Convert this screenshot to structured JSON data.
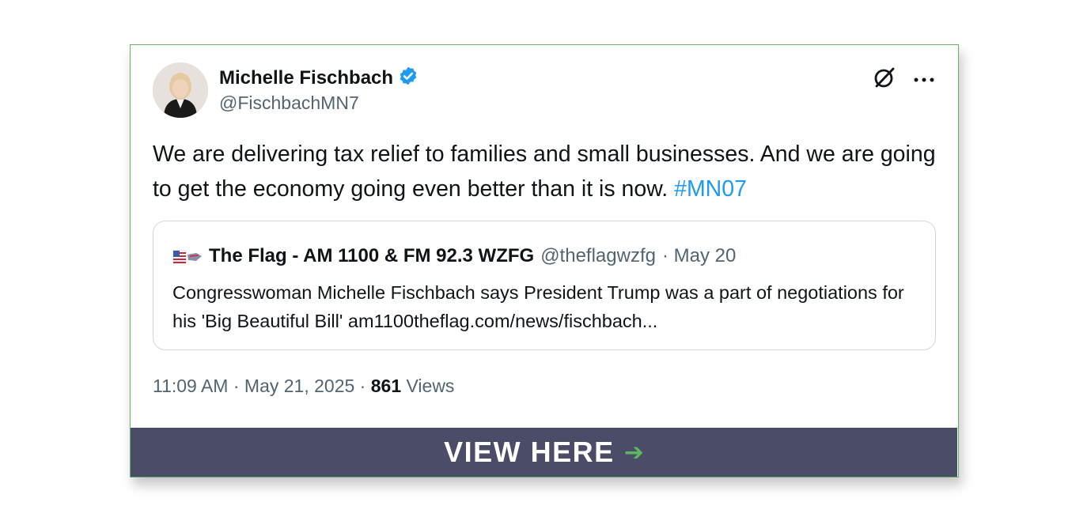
{
  "tweet": {
    "author_name": "Michelle Fischbach",
    "author_handle": "@FischbachMN7",
    "text_main": "We are delivering tax relief to families and small businesses. And we are going to get the economy going even better than it is now. ",
    "hashtag": "#MN07",
    "timestamp": "11:09 AM · May 21, 2025 · ",
    "views_count": "861",
    "views_label": " Views"
  },
  "quote": {
    "author_name": "The Flag - AM 1100 & FM 92.3 WZFG",
    "author_handle": "@theflagwzfg",
    "date": "· May 20",
    "text": "Congresswoman Michelle Fischbach says President Trump was a part of negotiations for his 'Big Beautiful Bill' am1100theflag.com/news/fischbach..."
  },
  "banner": {
    "label": "VIEW HERE",
    "arrow": "➔"
  },
  "icons": {
    "verified": "verified-badge-icon",
    "grok": "grok-icon",
    "more": "more-options-icon",
    "flag": "flag-icon"
  },
  "colors": {
    "accent_blue": "#1d9bf0",
    "banner_bg": "#4a4c68",
    "arrow_green": "#5cb85c",
    "card_border": "#6bb36b"
  }
}
